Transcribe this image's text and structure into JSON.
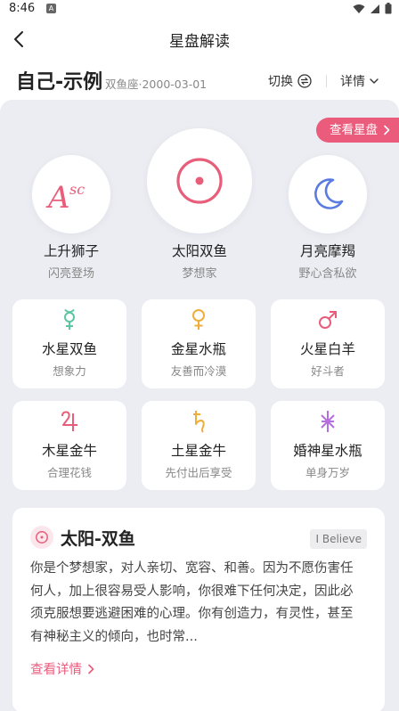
{
  "status_bar": {
    "time": "8:46",
    "notification_letter": "A"
  },
  "nav": {
    "title": "星盘解读"
  },
  "profile": {
    "name": "自己-示例",
    "meta": "双鱼座·2000-03-01",
    "switch_label": "切换",
    "detail_label": "详情"
  },
  "view_chart_label": "查看星盘",
  "big_three": [
    {
      "name": "上升狮子",
      "desc": "闪亮登场",
      "symbol": "Asc",
      "color": "#e85d7a",
      "icon": "ascendant-icon"
    },
    {
      "name": "太阳双鱼",
      "desc": "梦想家",
      "symbol": "☉",
      "color": "#e85d7a",
      "icon": "sun-icon"
    },
    {
      "name": "月亮摩羯",
      "desc": "野心含私欲",
      "symbol": "☽",
      "color": "#5a7ce0",
      "icon": "moon-icon"
    }
  ],
  "planets": [
    {
      "name": "水星双鱼",
      "desc": "想象力",
      "symbol": "☿",
      "color": "#5cc6a0",
      "icon": "mercury-icon"
    },
    {
      "name": "金星水瓶",
      "desc": "友善而冷漠",
      "symbol": "♀",
      "color": "#f0ad3c",
      "icon": "venus-icon"
    },
    {
      "name": "火星白羊",
      "desc": "好斗者",
      "symbol": "♂",
      "color": "#e85d7a",
      "icon": "mars-icon"
    },
    {
      "name": "木星金牛",
      "desc": "合理花钱",
      "symbol": "♃",
      "color": "#e85d7a",
      "icon": "jupiter-icon"
    },
    {
      "name": "土星金牛",
      "desc": "先付出后享受",
      "symbol": "♄",
      "color": "#f0ad3c",
      "icon": "saturn-icon"
    },
    {
      "name": "婚神星水瓶",
      "desc": "单身万岁",
      "symbol": "⚵",
      "color": "#b56ee0",
      "icon": "juno-icon"
    }
  ],
  "reading": {
    "title": "太阳-双鱼",
    "badge": "I Believe",
    "text": "你是个梦想家，对人亲切、宽容、和善。因为不愿伤害任何人，加上很容易受人影响，你很难下任何决定，因此必须克服想要逃避困难的心理。你有创造力，有灵性，甚至有神秘主义的倾向，也时常...",
    "see_more": "查看详情"
  },
  "colors": {
    "accent": "#ea5b7c",
    "background": "#ecedf2"
  }
}
